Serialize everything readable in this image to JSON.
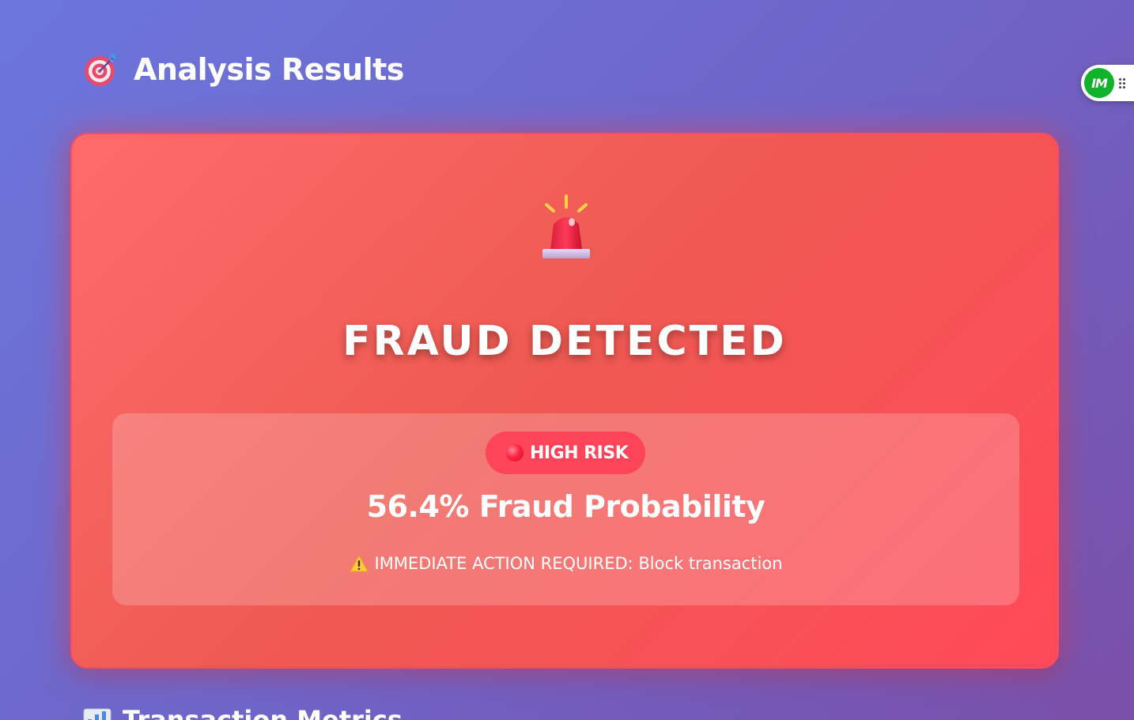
{
  "header": {
    "icon": "target-icon",
    "title": "Analysis Results"
  },
  "floating_widget": {
    "logo_text": "IM",
    "logo_color": "#10b22a",
    "handle_icon": "drag-handle-icon"
  },
  "result": {
    "alert_icon": "siren-icon",
    "verdict": "FRAUD DETECTED",
    "risk_badge": {
      "icon": "red-circle-icon",
      "label": "HIGH RISK",
      "color": "#fe4458"
    },
    "probability": 56.4,
    "probability_text": "56.4% Fraud Probability",
    "action": {
      "icon": "warning-icon",
      "text": "IMMEDIATE ACTION REQUIRED: Block transaction"
    }
  },
  "next_section": {
    "icon": "bar-chart-icon",
    "title": "Transaction Metrics"
  },
  "colors": {
    "background_start": "#6c76dc",
    "background_end": "#7a4fa8",
    "card_start": "#fe6b6b",
    "card_end": "#ff4a59",
    "card_border": "#ff4b5e"
  }
}
